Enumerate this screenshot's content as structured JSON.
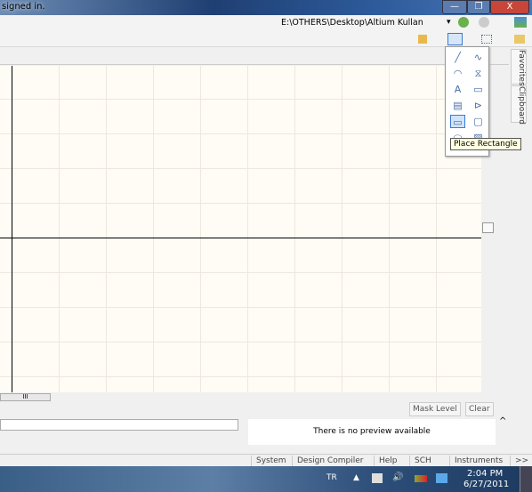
{
  "window": {
    "title": "signed in.",
    "min": "—",
    "max": "❐",
    "close": "X"
  },
  "toolbar": {
    "path": "E:\\OTHERS\\Desktop\\Altium Kullan",
    "path_dropdown": "▾"
  },
  "right_tabs": [
    "Favorites",
    "Clipboard"
  ],
  "palette": {
    "items": [
      "line-icon",
      "bezier-icon",
      "arc-icon",
      "polygon-icon",
      "text-icon",
      "text-frame-icon",
      "part-icon",
      "port-icon",
      "rectangle-icon",
      "rounded-rectangle-icon",
      "ellipse-icon",
      "graphic-icon"
    ],
    "selected_index": 8,
    "tooltip": "Place Rectangle"
  },
  "scroll": {
    "h_thumb": "III",
    "collapse": "^"
  },
  "mask": {
    "mask_level": "Mask Level",
    "clear": "Clear"
  },
  "preview": {
    "text": "There is no preview available"
  },
  "statusbar": {
    "items": [
      "System",
      "Design Compiler",
      "Help",
      "SCH",
      "Instruments",
      ">>"
    ]
  },
  "taskbar": {
    "lang": "TR",
    "time": "2:04 PM",
    "date": "6/27/2011"
  }
}
